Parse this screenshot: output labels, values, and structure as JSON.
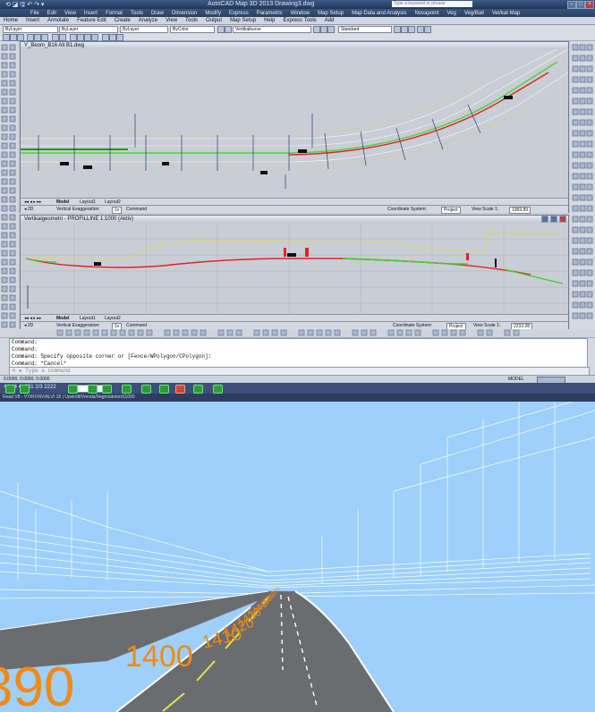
{
  "app": {
    "title": "AutoCAD Map 3D 2013    Drawing3.dwg",
    "quick_access": "⟲ ◪ 🖫 ↶ ↷ ▾",
    "search_placeholder": "Type a keyword or phrase"
  },
  "menubar": [
    "File",
    "Edit",
    "View",
    "Insert",
    "Format",
    "Tools",
    "Draw",
    "Dimension",
    "Modify",
    "Express",
    "Parametric",
    "Window",
    "Map Setup",
    "Map Data and Analysis",
    "Novapoint",
    "Veg",
    "Veg/Ball",
    "Vei/kat Map"
  ],
  "ribbon_tabs": [
    "Home",
    "Insert",
    "Annotate",
    "Feature Edit",
    "Create",
    "Analyze",
    "View",
    "Tools",
    "Output",
    "Map Setup",
    "Help",
    "Express Tools",
    "Add"
  ],
  "toolbar": {
    "layer": "ByLayer",
    "color": "ByLayer",
    "linetype": "ByLayer",
    "lineweight": "ByColor",
    "workspace": "Vertikalkurve",
    "standard": "Standard"
  },
  "plan_window": {
    "title": "Y_Beom_B16      Alt B1.dwg",
    "tabs": [
      "Model",
      "Layout1",
      "Layout2"
    ],
    "vertical_exaggeration_label": "Vertical Exaggeration:",
    "vertical_exaggeration": "1x",
    "command_tab": "Command",
    "coordinate_label": "Coordinate System:",
    "coordinate_value": "Project",
    "view_scale_label": "View Scale 1:",
    "view_scale_value": "1969.89"
  },
  "profile_window": {
    "title": "Vertikalgeometri - PROFILLINE 1:1000 (Aktiv)",
    "tabs": [
      "Model",
      "Layout1",
      "Layout2"
    ],
    "vertical_exaggeration_label": "Vertical Exaggeration:",
    "vertical_exaggeration": "1x",
    "command_tab": "Command",
    "coordinate_label": "Coordinate System:",
    "coordinate_value": "Project",
    "view_scale_label": "View Scale 1:",
    "view_scale_value": "2232.28"
  },
  "command": {
    "lines": [
      "Command:",
      "Command:",
      "Command: Specify opposite corner or [Fence/WPolygon/CPolygon]:",
      "Command: *Cancel*"
    ],
    "input_placeholder": "Type a command"
  },
  "statusbar": {
    "coords": "0.0000, 0.0000, 0.0000",
    "model": "MODEL"
  },
  "viewer": {
    "counter": "44  44 4+201 2/3 2222",
    "path": "Road V8 - VY/RONV/ALVI 18 | Upskrift/Vrenda/Vegmodelen/11000",
    "stations": [
      "390",
      "1400",
      "1410",
      "1420",
      "1430",
      "1440",
      "1450",
      "1460",
      "1470"
    ]
  },
  "colors": {
    "sky": "#9ed0fb",
    "road": "#6b6c70",
    "centerline": "#dfe646",
    "station_label": "#f08a16",
    "profile_red": "#e3231c",
    "profile_green": "#3bd12c",
    "profile_yellow": "#e4d845"
  }
}
